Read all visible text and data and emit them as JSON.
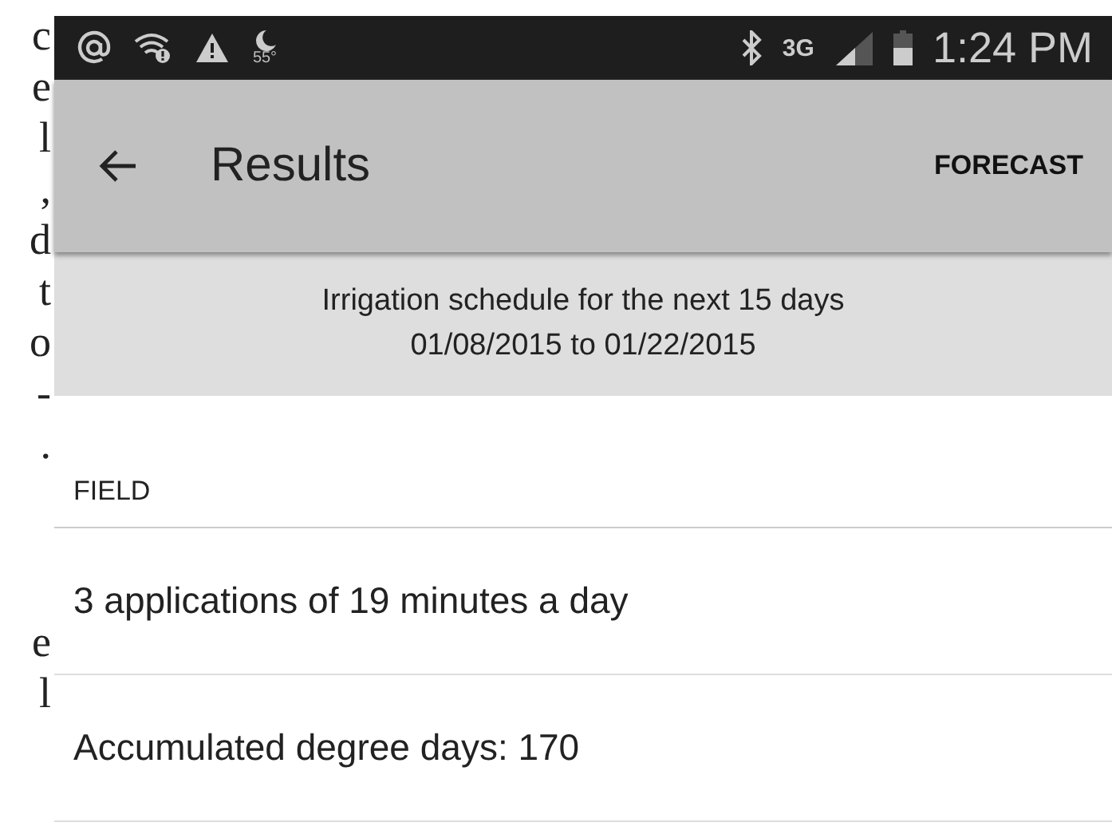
{
  "margin_text": [
    [
      "c",
      "e",
      "l",
      ",",
      "d",
      "t",
      "o",
      "-",
      "."
    ],
    [
      "e",
      "l"
    ]
  ],
  "status_bar": {
    "temperature": "55°",
    "network": "3G",
    "time": "1:24 PM"
  },
  "app_bar": {
    "title": "Results",
    "action": "FORECAST"
  },
  "banner": {
    "lines": [
      "Irrigation schedule for the next 15 days",
      "01/08/2015 to 01/22/2015"
    ]
  },
  "section": {
    "header": "FIELD",
    "rows": [
      "3 applications of 19 minutes a day",
      "Accumulated degree days: 170"
    ]
  }
}
